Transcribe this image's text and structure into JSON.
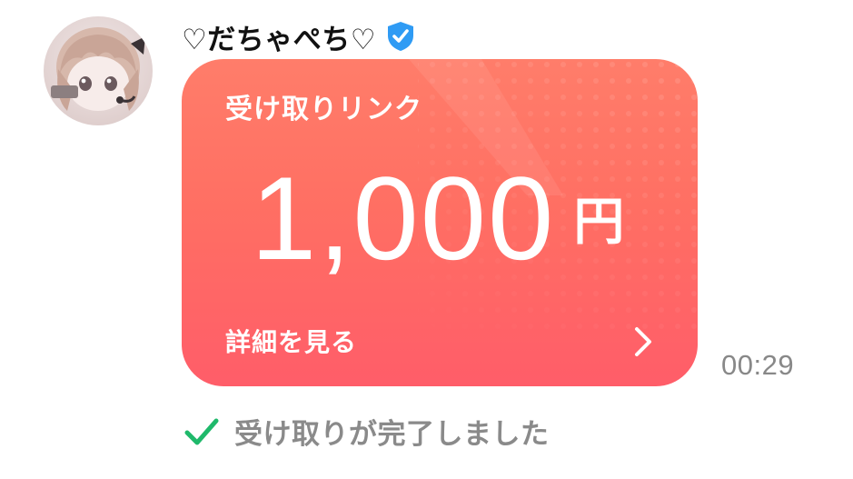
{
  "sender": {
    "name": "♡だちゃぺち♡",
    "verified_icon": "verified-shield-icon",
    "avatar_tag": "だちゃ"
  },
  "card": {
    "title": "受け取りリンク",
    "amount": "1,000",
    "currency": "円",
    "details_label": "詳細を見る",
    "chevron_icon": "chevron-right-icon",
    "colors": {
      "gradient_top": "#ff7d6a",
      "gradient_mid": "#ff6f63",
      "gradient_bottom": "#ff5d69"
    }
  },
  "message": {
    "time": "00:29"
  },
  "status": {
    "icon": "check-icon",
    "text": "受け取りが完了しました",
    "icon_color": "#1fb96b"
  }
}
